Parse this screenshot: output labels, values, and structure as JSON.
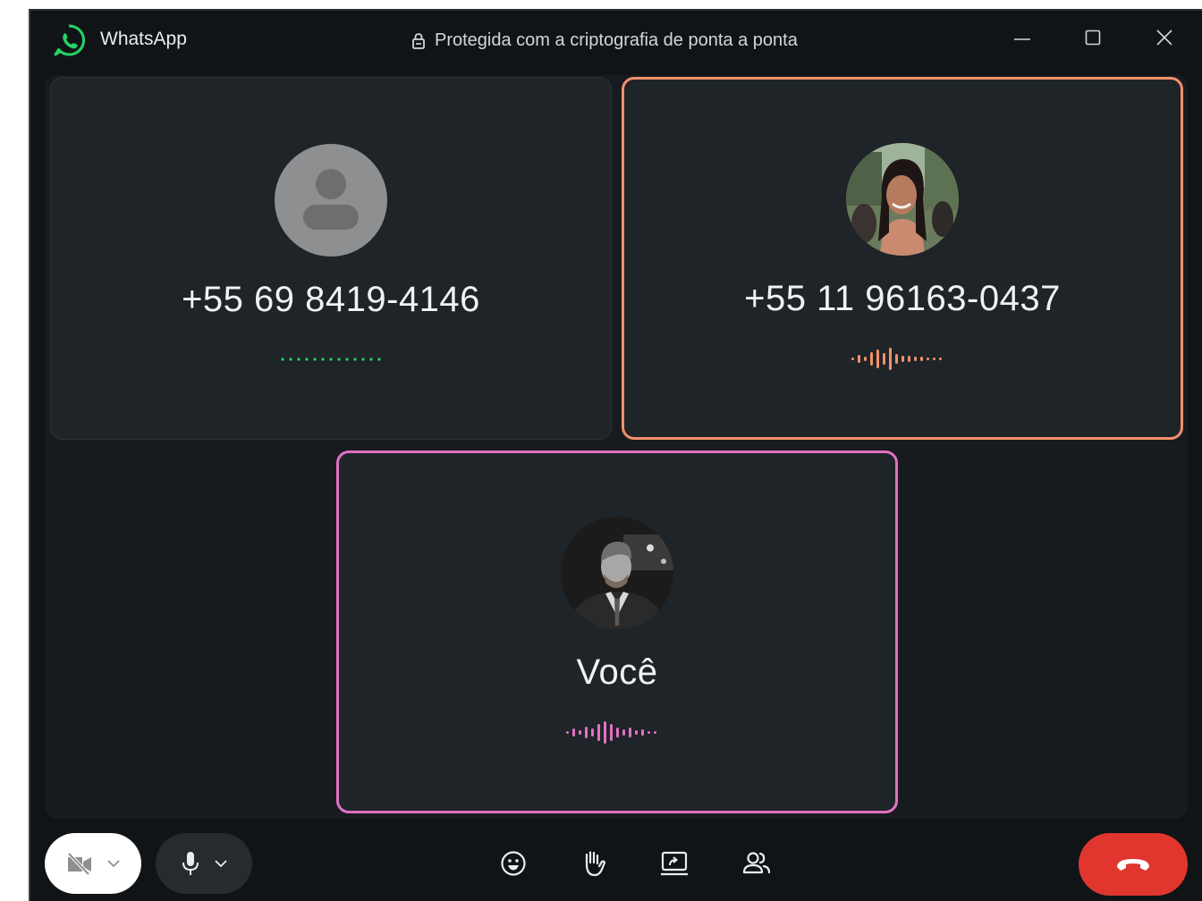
{
  "window": {
    "app_title": "WhatsApp",
    "encryption_notice": "Protegida com a criptografia de ponta a ponta"
  },
  "participants": [
    {
      "name": "+55 69 8419-4146",
      "avatar": "default-person-icon",
      "status": "connecting",
      "indicator_color": "#25d366"
    },
    {
      "name": "+55 11 96163-0437",
      "avatar": "photo",
      "status": "speaking",
      "highlight_color": "#f0916a"
    },
    {
      "name": "Você",
      "avatar": "photo",
      "status": "speaking",
      "highlight_color": "#e171c3"
    }
  ],
  "controls": {
    "video": {
      "icon": "video-off-icon",
      "menu_icon": "chevron-down-icon"
    },
    "mic": {
      "icon": "microphone-icon",
      "menu_icon": "chevron-down-icon"
    },
    "react": {
      "icon": "emoji-icon"
    },
    "raise_hand": {
      "icon": "raise-hand-icon"
    },
    "share_screen": {
      "icon": "screen-share-icon"
    },
    "participants": {
      "icon": "participants-icon"
    },
    "end_call": {
      "icon": "hang-up-icon",
      "color": "#e0362e"
    }
  },
  "colors": {
    "background": "#111417",
    "tile": "#1f2428",
    "whatsapp_green": "#25d366"
  }
}
